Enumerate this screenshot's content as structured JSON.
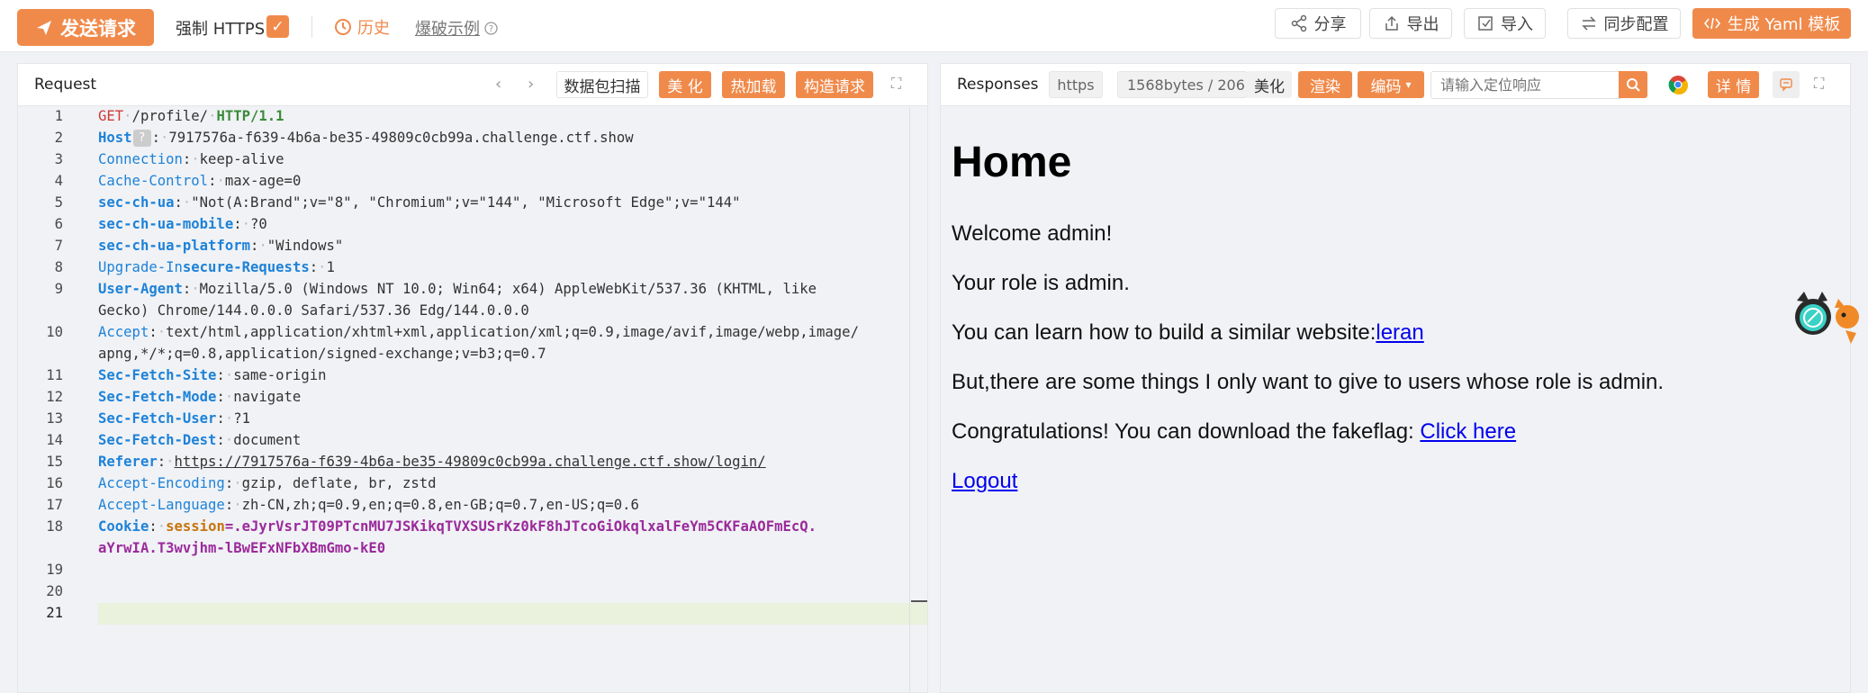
{
  "toolbar": {
    "send_label": "发送请求",
    "force_https_label": "强制 HTTPS",
    "history_label": "历史",
    "example_label": "爆破示例",
    "share_label": "分享",
    "export_label": "导出",
    "import_label": "导入",
    "sync_label": "同步配置",
    "yaml_label": "生成 Yaml 模板"
  },
  "request": {
    "title": "Request",
    "scan_label": "数据包扫描",
    "beautify_label": "美 化",
    "hotload_label": "热加载",
    "build_label": "构造请求",
    "lines": [
      {
        "n": "1"
      },
      {
        "n": "2"
      },
      {
        "n": "3"
      },
      {
        "n": "4"
      },
      {
        "n": "5"
      },
      {
        "n": "6"
      },
      {
        "n": "7"
      },
      {
        "n": "8"
      },
      {
        "n": "9"
      },
      {
        "n": "10"
      },
      {
        "n": "11"
      },
      {
        "n": "12"
      },
      {
        "n": "13"
      },
      {
        "n": "14"
      },
      {
        "n": "15"
      },
      {
        "n": "16"
      },
      {
        "n": "17"
      },
      {
        "n": "18"
      },
      {
        "n": "19"
      },
      {
        "n": "20"
      },
      {
        "n": "21"
      }
    ],
    "code": {
      "l1_method": "GET",
      "l1_path": "/profile/",
      "l1_version": "HTTP/1.1",
      "l2_key": "Host",
      "l2_val": "7917576a-f639-4b6a-be35-49809c0cb99a.challenge.ctf.show",
      "l3_key": "Connection",
      "l3_val": "keep-alive",
      "l4_key": "Cache-Control",
      "l4_val": "max-age=0",
      "l5_key": "sec-ch-ua",
      "l5_val": "\"Not(A:Brand\";v=\"8\", \"Chromium\";v=\"144\", \"Microsoft Edge\";v=\"144\"",
      "l6_key": "sec-ch-ua-mobile",
      "l6_val": "?0",
      "l7_key": "sec-ch-ua-platform",
      "l7_val": "\"Windows\"",
      "l8_key_a": "Upgrade-In",
      "l8_key_b": "secure-Requests",
      "l8_val": "1",
      "l9_key": "User-Agent",
      "l9_val": "Mozilla/5.0 (Windows NT 10.0; Win64; x64) AppleWebKit/537.36 (KHTML, like",
      "l9_val2": "Gecko) Chrome/144.0.0.0 Safari/537.36 Edg/144.0.0.0",
      "l10_key": "Accept",
      "l10_val": "text/html,application/xhtml+xml,application/xml;q=0.9,image/avif,image/webp,image/",
      "l10_val2": "apng,*/*;q=0.8,application/signed-exchange;v=b3;q=0.7",
      "l11_key": "Sec-Fetch-Site",
      "l11_val": "same-origin",
      "l12_key": "Sec-Fetch-Mode",
      "l12_val": "navigate",
      "l13_key": "Sec-Fetch-User",
      "l13_val": "?1",
      "l14_key": "Sec-Fetch-Dest",
      "l14_val": "document",
      "l15_key": "Referer",
      "l15_val": "https://7917576a-f639-4b6a-be35-49809c0cb99a.challenge.ctf.show/login/",
      "l16_key": "Accept-Encoding",
      "l16_val": "gzip, deflate, br, zstd",
      "l17_key": "Accept-Language",
      "l17_val": "zh-CN,zh;q=0.9,en;q=0.8,en-GB;q=0.7,en-US;q=0.6",
      "l18_key": "Cookie",
      "l18_ckey": "session",
      "l18_val": "=.eJyrVsrJT09PTcnMU7JSKikqTVXSUSrKz0kF8hJTcoGiOkqlxalFeYm5CKFaAOFmEcQ.",
      "l18_val2": "aYrwIA.T3wvjhm-lBwEFxNFbXBmGmo-kE0"
    }
  },
  "response": {
    "title": "Responses",
    "protocol": "https",
    "size": "1568bytes / 206",
    "beautify_label": "美化",
    "render_label": "渲染",
    "encoding_label": "编码",
    "search_placeholder": "请输入定位响应",
    "detail_label": "详 情",
    "page": {
      "heading": "Home",
      "p1": "Welcome admin!",
      "p2": "Your role is admin.",
      "p3_text": "You can learn how to build a similar website:",
      "p3_link": "leran",
      "p4": "But,there are some things I only want to give to users whose role is admin.",
      "p5_text": "Congratulations! You can download the fakeflag: ",
      "p5_link": "Click here",
      "p6_link": "Logout"
    }
  },
  "colors": {
    "accent": "#f08a4b",
    "header_key": "#1e82d8",
    "method": "#d13a3a",
    "cookie_value": "#9b2a9b",
    "link": "#0000ee"
  },
  "icons": [
    "send-icon",
    "check-icon",
    "clock-icon",
    "help-icon",
    "share-icon",
    "export-icon",
    "import-icon",
    "sync-icon",
    "code-icon",
    "chevron-left-icon",
    "chevron-right-icon",
    "expand-icon",
    "search-icon",
    "chrome-icon",
    "comment-icon",
    "mascot-icon"
  ]
}
